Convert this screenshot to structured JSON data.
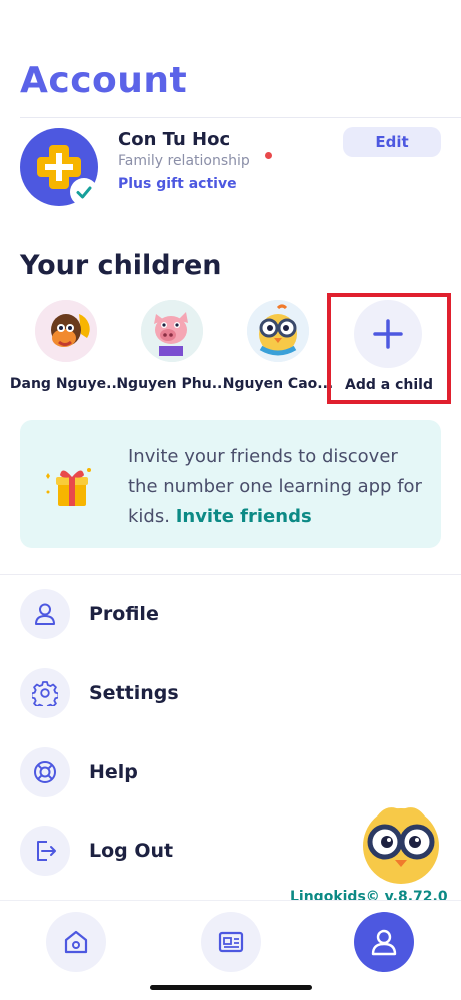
{
  "header": {
    "title": "Account"
  },
  "profile": {
    "name": "Con Tu Hoc",
    "relationship": "Family relationship",
    "gift_status": "Plus gift active",
    "edit_label": "Edit"
  },
  "children": {
    "title": "Your children",
    "items": [
      {
        "name": "Dang Nguye..."
      },
      {
        "name": "Nguyen Phu..."
      },
      {
        "name": "Nguyen Cao..."
      }
    ],
    "add_label": "Add a child"
  },
  "invite": {
    "text": "Invite your friends to discover the number one learning app for kids.",
    "link_label": "Invite friends"
  },
  "menu": {
    "items": [
      {
        "label": "Profile",
        "icon": "person-icon"
      },
      {
        "label": "Settings",
        "icon": "gear-icon"
      },
      {
        "label": "Help",
        "icon": "lifebuoy-icon"
      },
      {
        "label": "Log Out",
        "icon": "logout-icon"
      }
    ]
  },
  "footer": {
    "version": "Lingokids© v.8.72.0"
  },
  "bottom_nav": {
    "items": [
      "home-icon",
      "news-icon",
      "account-icon"
    ],
    "active": "account-icon"
  },
  "colors": {
    "brand": "#5b63e8",
    "accent": "#4d58e0",
    "teal": "#0c8a85",
    "highlight": "#e0202e"
  }
}
